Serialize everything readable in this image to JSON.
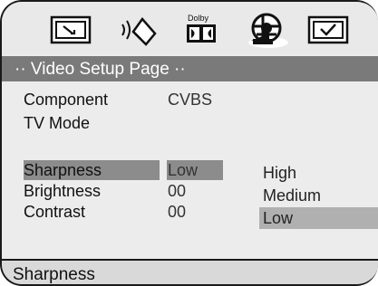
{
  "menu_tabs": [
    {
      "icon": "general-setup-icon"
    },
    {
      "icon": "speaker-setup-icon"
    },
    {
      "icon": "dolby-digital-setup-icon",
      "label": "Dolby"
    },
    {
      "icon": "video-setup-icon"
    },
    {
      "icon": "preference-setup-icon"
    }
  ],
  "page_title": "·· Video Setup Page ··",
  "settings": [
    {
      "label": "Component",
      "value": "CVBS"
    },
    {
      "label": "TV Mode",
      "value": ""
    },
    {
      "label": "Sharpness",
      "value": "Low"
    },
    {
      "label": "Brightness",
      "value": "00"
    },
    {
      "label": "Contrast",
      "value": "00"
    }
  ],
  "selected_setting_index": 2,
  "options": [
    {
      "label": "High"
    },
    {
      "label": "Medium"
    },
    {
      "label": "Low"
    }
  ],
  "selected_option_index": 2,
  "status_text": "Sharpness",
  "colors": {
    "background": "#ececec",
    "title_bar": "#7a7a7a",
    "highlight": "#8c8c8c",
    "option_highlight": "#b0b0b0",
    "status_bar": "#d9d9d9"
  }
}
